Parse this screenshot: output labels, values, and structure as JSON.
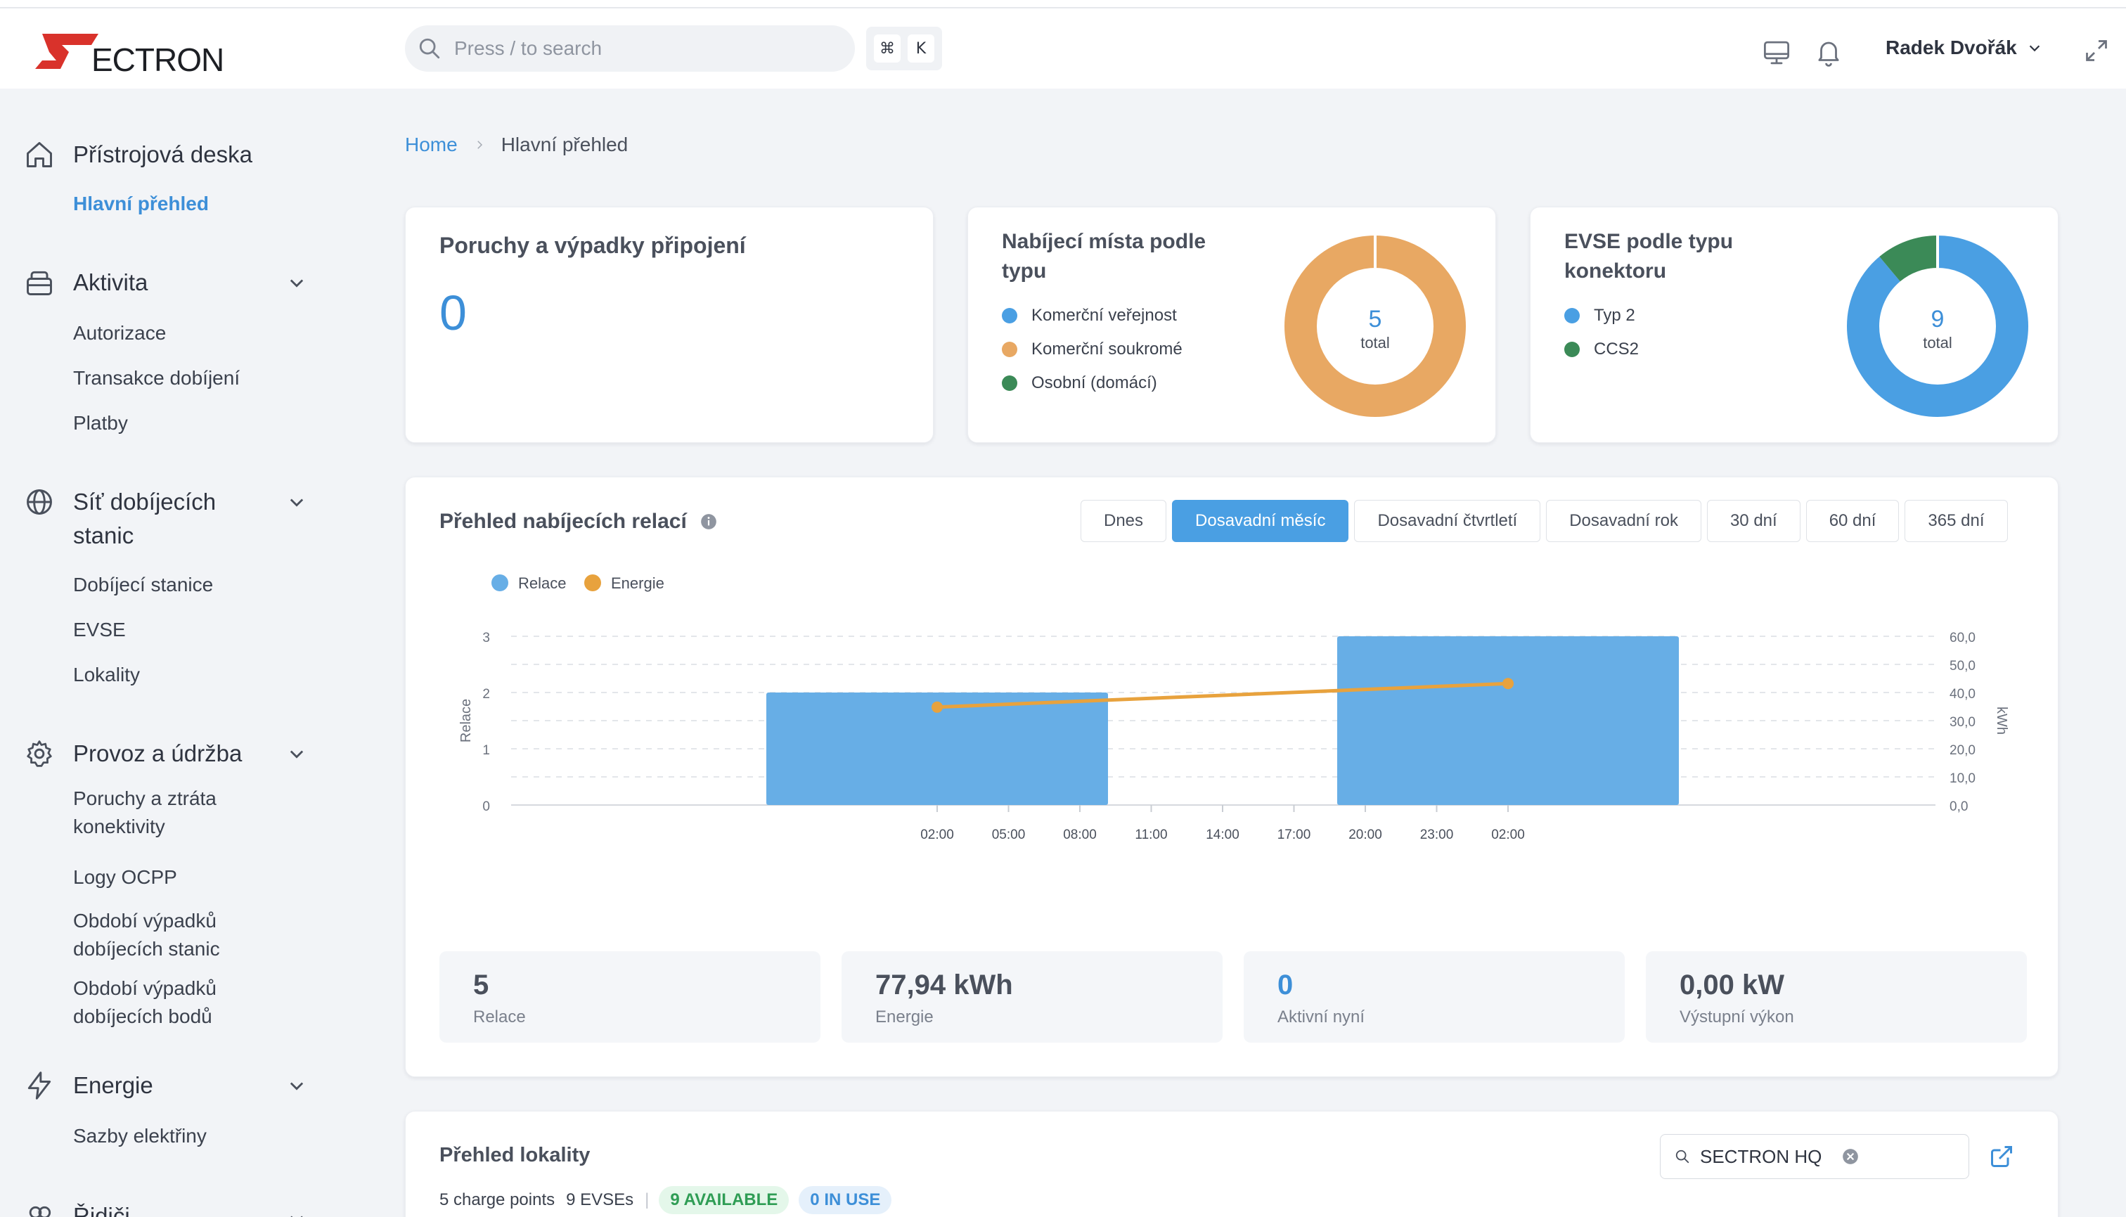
{
  "header": {
    "logo_text": "ECTRON",
    "search_placeholder": "Press / to search",
    "kbd": [
      "⌘",
      "K"
    ],
    "user_name": "Radek Dvořák"
  },
  "sidebar": {
    "groups": [
      {
        "label": "Přístrojová deska",
        "icon": "home-icon",
        "items": [
          "Hlavní přehled"
        ]
      },
      {
        "label": "Aktivita",
        "icon": "bag-icon",
        "items": [
          "Autorizace",
          "Transakce dobíjení",
          "Platby"
        ]
      },
      {
        "label_lines": [
          "Síť dobíjecích",
          "stanic"
        ],
        "icon": "globe-icon",
        "items": [
          "Dobíjecí stanice",
          "EVSE",
          "Lokality"
        ]
      },
      {
        "label": "Provoz a údržba",
        "icon": "gear-icon",
        "items": [
          [
            "Poruchy a ztráta",
            "konektivity"
          ],
          [
            "Logy OCPP"
          ],
          [
            "Období výpadků",
            "dobíjecích stanic"
          ],
          [
            "Období výpadků",
            "dobíjecích bodů"
          ]
        ]
      },
      {
        "label": "Energie",
        "icon": "bolt-icon",
        "items": [
          "Sazby elektřiny"
        ]
      },
      {
        "label": "Řidiči",
        "icon": "users-icon",
        "items": []
      }
    ]
  },
  "breadcrumb": {
    "home": "Home",
    "current": "Hlavní přehled"
  },
  "cards": {
    "faults": {
      "title": "Poruchy a výpadky připojení",
      "value": "0"
    },
    "by_type": {
      "title_lines": [
        "Nabíjecí místa podle",
        "typu"
      ],
      "legend": [
        {
          "label": "Komerční veřejnost",
          "color": "#4a9fe3"
        },
        {
          "label": "Komerční soukromé",
          "color": "#e8a863"
        },
        {
          "label": "Osobní (domácí)",
          "color": "#3b8a57"
        }
      ],
      "total": "5",
      "total_label": "total",
      "slices": [
        0,
        5,
        0
      ]
    },
    "by_connector": {
      "title_lines": [
        "EVSE podle typu",
        "konektoru"
      ],
      "legend": [
        {
          "label": "Typ 2",
          "color": "#4a9fe3"
        },
        {
          "label": "CCS2",
          "color": "#3b8a57"
        }
      ],
      "total": "9",
      "total_label": "total",
      "slices": [
        8,
        1
      ]
    }
  },
  "sessions": {
    "title": "Přehled nabíjecích relací",
    "ranges": [
      "Dnes",
      "Dosavadní měsíc",
      "Dosavadní čtvrtletí",
      "Dosavadní rok",
      "30 dní",
      "60 dní",
      "365 dní"
    ],
    "active_range": "Dosavadní měsíc",
    "stats": [
      {
        "value": "5",
        "label": "Relace"
      },
      {
        "value": "77,94 kWh",
        "label": "Energie"
      },
      {
        "value": "0",
        "label": "Aktivní nyní"
      },
      {
        "value": "0,00 kW",
        "label": "Výstupní výkon"
      }
    ]
  },
  "chart_data": {
    "type": "bar",
    "categories": [
      "02:00",
      "05:00",
      "08:00",
      "11:00",
      "14:00",
      "17:00",
      "20:00",
      "23:00",
      "02:00"
    ],
    "series": [
      {
        "name": "Relace",
        "type": "bar",
        "axis": "left",
        "color": "#67aee6",
        "points": [
          {
            "x": "02:00",
            "y": 2
          },
          {
            "x": "02:00 (2)",
            "y": 3
          }
        ]
      },
      {
        "name": "Energie",
        "type": "line",
        "axis": "right",
        "color": "#e8a23d",
        "points": [
          {
            "x": "02:00",
            "y": 34.8
          },
          {
            "x": "02:00 (2)",
            "y": 43.2
          }
        ]
      }
    ],
    "ylabel": "Relace",
    "y2label": "kWh",
    "yticks": [
      "0",
      "1",
      "2",
      "3"
    ],
    "y2ticks": [
      "0,0",
      "10,0",
      "20,0",
      "30,0",
      "40,0",
      "50,0",
      "60,0"
    ],
    "ylim": [
      0,
      3
    ],
    "y2lim": [
      0,
      60
    ],
    "grid": true,
    "legend": "top-left"
  },
  "locations": {
    "title": "Přehled lokality",
    "search_value": "SECTRON HQ",
    "charge_points": "5 charge points",
    "evses": "9 EVSEs",
    "available": "9 AVAILABLE",
    "in_use": "0 IN USE"
  }
}
